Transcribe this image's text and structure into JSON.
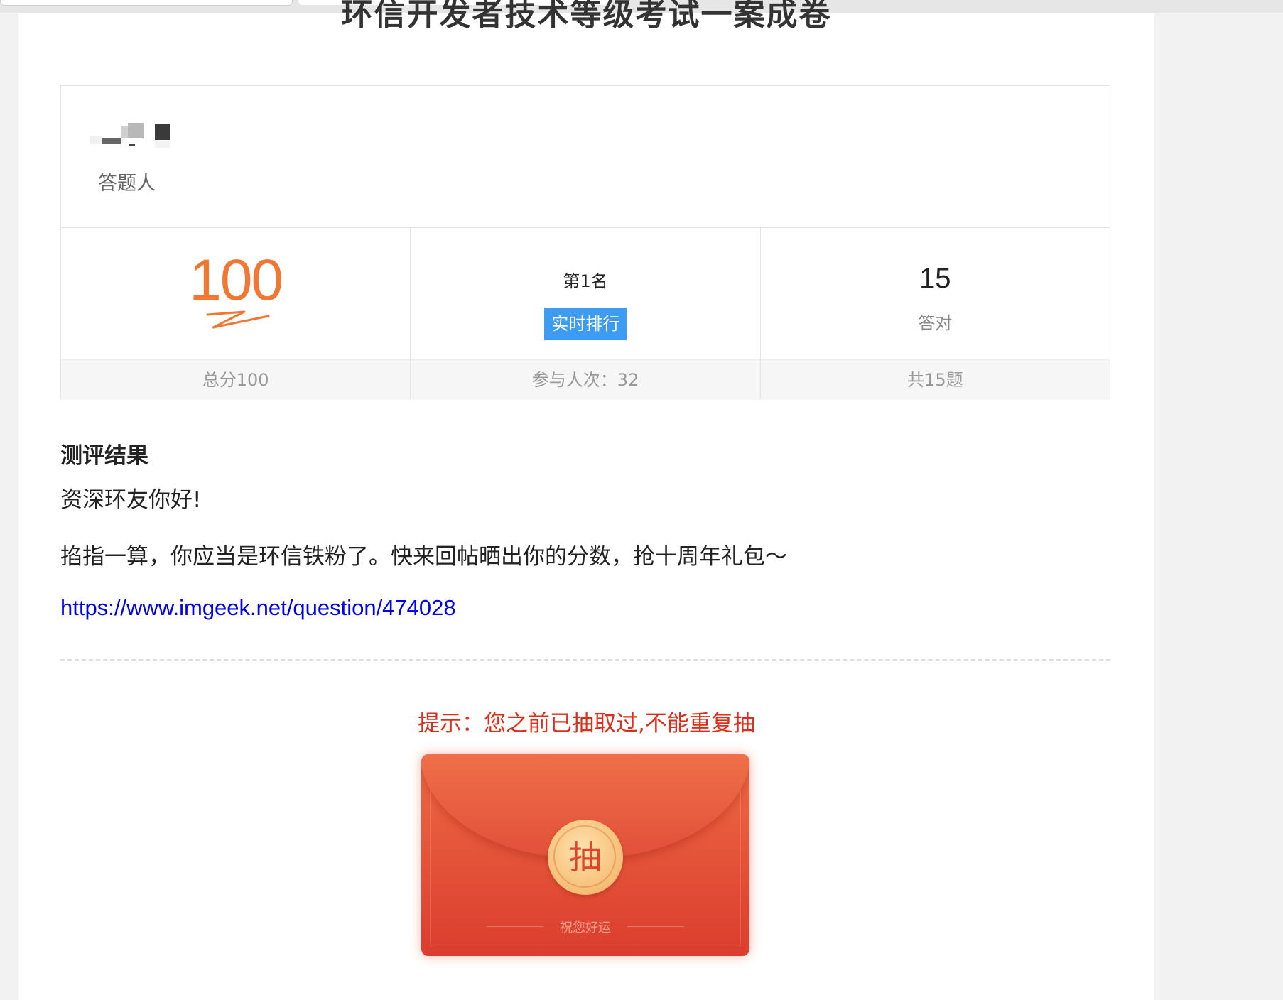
{
  "exam": {
    "title": "环信开发者技术等级考试一案成卷"
  },
  "answerer": {
    "label": "答题人"
  },
  "stats": {
    "score": "100",
    "score_total": "总分100",
    "rank": "第1名",
    "rank_button": "实时排行",
    "participants": "参与人次：32",
    "correct_count": "15",
    "correct_label": "答对",
    "total_questions": "共15题"
  },
  "result": {
    "title": "测评结果",
    "greeting": "资深环友你好!",
    "message": "掐指一算，你应当是环信铁粉了。快来回帖晒出你的分数，抢十周年礼包～",
    "link": "https://www.imgeek.net/question/474028"
  },
  "lottery": {
    "hint": "提示：您之前已抽取过,不能重复抽",
    "button_label": "抽",
    "wish": "祝您好运"
  },
  "colors": {
    "score": "#f07834",
    "rank_button": "#3d9cf2",
    "link": "#0000e6",
    "hint": "#e02d1a",
    "envelope": "#db3d2f"
  }
}
